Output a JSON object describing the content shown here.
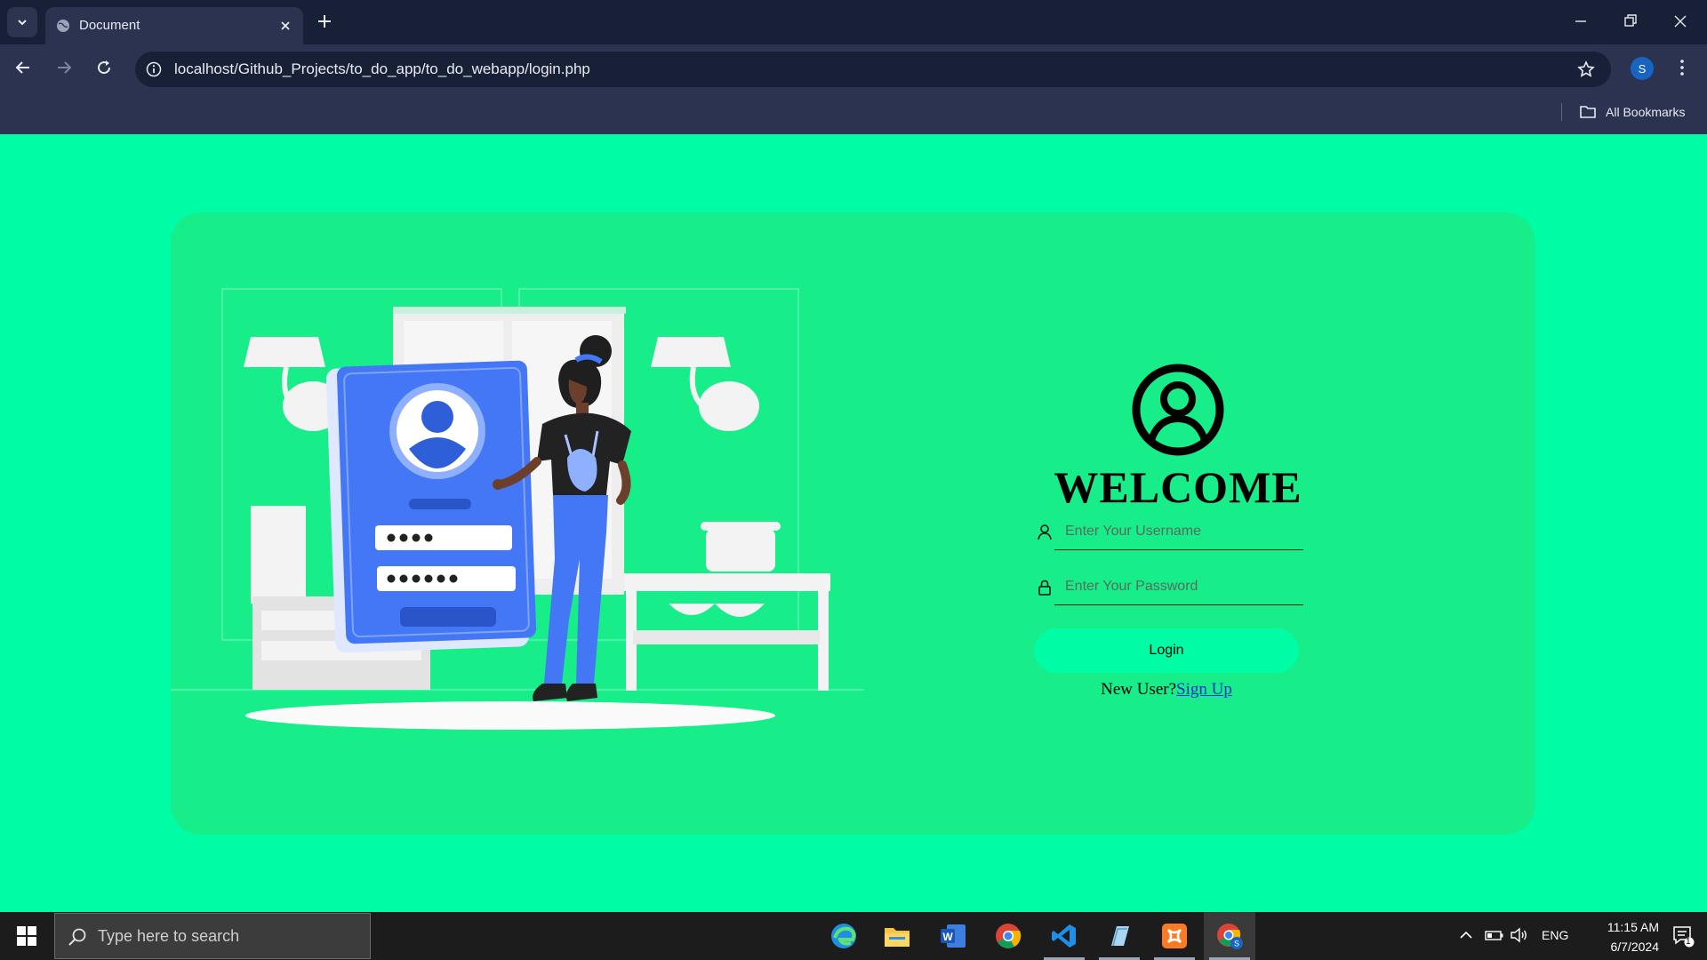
{
  "browser": {
    "tab": {
      "title": "Document"
    },
    "address_bar": {
      "url": "localhost/Github_Projects/to_do_app/to_do_webapp/login.php"
    },
    "profile_initial": "S",
    "bookmarks_bar": {
      "all_bookmarks_label": "All Bookmarks"
    }
  },
  "login": {
    "heading": "WELCOME",
    "username_placeholder": "Enter Your Username",
    "password_placeholder": "Enter Your Password",
    "login_button": "Login",
    "new_user_text": "New User?",
    "signup_link": "Sign Up"
  },
  "colors": {
    "page_background": "#00fca4",
    "card_background": "#17ed88",
    "button_background": "#00fca4",
    "illustration_blue": "#4377f5"
  },
  "taskbar": {
    "search_placeholder": "Type here to search",
    "pinned_apps": [
      "edge-icon",
      "file-explorer-icon",
      "word-icon",
      "chrome-icon",
      "vscode-icon",
      "notepad-icon",
      "xampp-icon",
      "chrome-profile-icon"
    ],
    "language": "ENG",
    "time": "11:15 AM",
    "date": "6/7/2024",
    "notification_count": "1"
  }
}
